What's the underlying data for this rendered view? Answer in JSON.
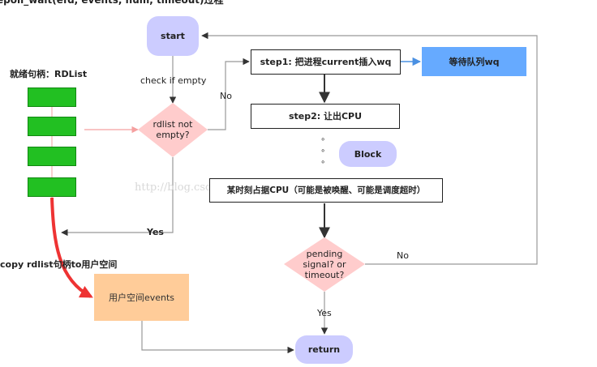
{
  "heading": "epoll_wait(efd, events, num, timeout)过程",
  "nodes": {
    "start": "start",
    "step1": "step1: 把进程current插入wq",
    "wait_queue": "等待队列wq",
    "step2": "step2: 让出CPU",
    "block": "Block",
    "occupy": "某时刻占据CPU（可能是被唤醒、可能是调度超时）",
    "rdlist_check": "rdlist not\nempty?",
    "pending_check": "pending\nsignal? or\ntimeout?",
    "user_events": "用户空间events",
    "return": "return"
  },
  "labels": {
    "check_if_empty": "check if empty",
    "no_1": "No",
    "yes_1": "Yes",
    "no_2": "No",
    "yes_2": "Yes",
    "ready_handle": "就绪句柄：RDList",
    "copy": "copy rdlist句柄to用户空间",
    "ellipsis": "∘\n∘\n∘"
  },
  "watermark": "http://blog.csdn.net/",
  "colors": {
    "pill": "#ccccff",
    "blue_box": "#66aaff",
    "diamond": "#ffcccc",
    "orange_box": "#ffcc99",
    "green_block": "#22c022",
    "red_arrow": "#ee3333"
  }
}
